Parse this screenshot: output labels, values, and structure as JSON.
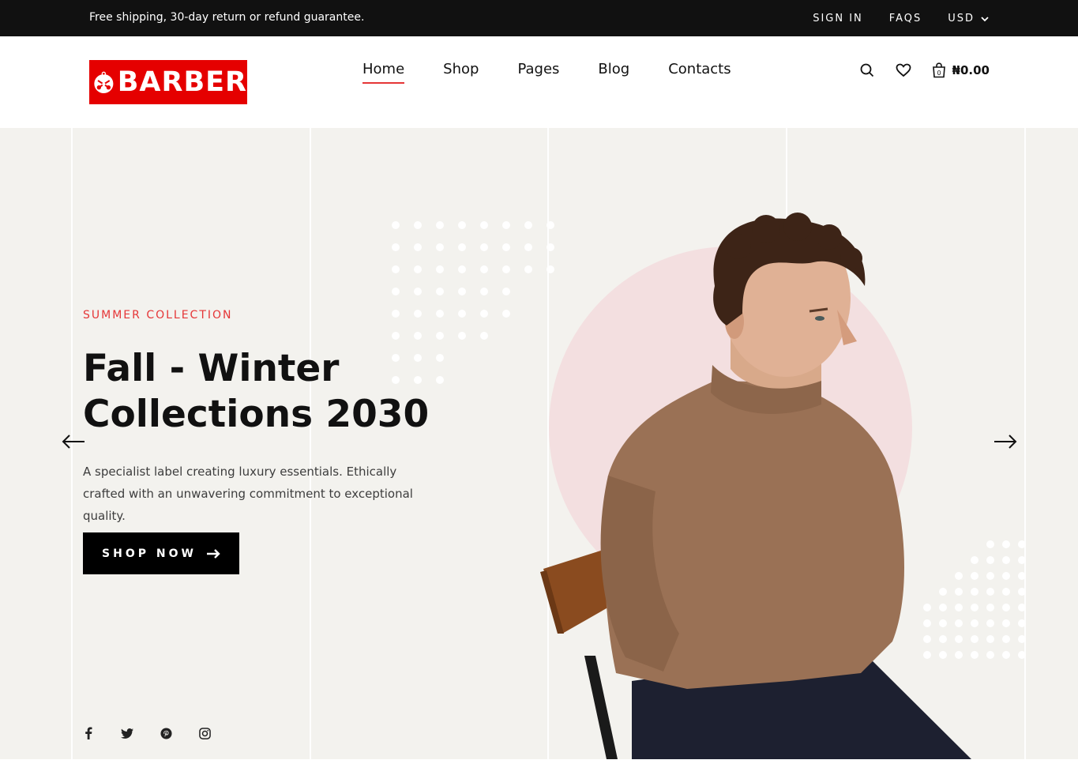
{
  "topbar": {
    "promo": "Free shipping, 30-day return or refund guarantee.",
    "sign_in": "SIGN IN",
    "faqs": "FAQS",
    "currency": "USD"
  },
  "header": {
    "logo_text": "BARBER",
    "nav": [
      {
        "label": "Home",
        "active": true
      },
      {
        "label": "Shop"
      },
      {
        "label": "Pages"
      },
      {
        "label": "Blog"
      },
      {
        "label": "Contacts"
      }
    ],
    "cart_count": "0",
    "cart_total": "₦0.00",
    "icons": [
      "search-icon",
      "heart-icon",
      "shopping-bag-icon"
    ]
  },
  "hero": {
    "kicker": "SUMMER COLLECTION",
    "headline_line1": "Fall - Winter",
    "headline_line2": "Collections 2030",
    "description": "A specialist label creating luxury essentials. Ethically crafted with an unwavering commitment to exceptional quality.",
    "cta_label": "SHOP NOW",
    "social_icons": [
      "facebook-icon",
      "twitter-icon",
      "pinterest-icon",
      "instagram-icon"
    ]
  },
  "colors": {
    "accent": "#e53637",
    "logo_bg": "#e50000",
    "hero_bg": "#f3f2ee",
    "circle": "#f3dfe0",
    "sweater": "#9a7155"
  }
}
